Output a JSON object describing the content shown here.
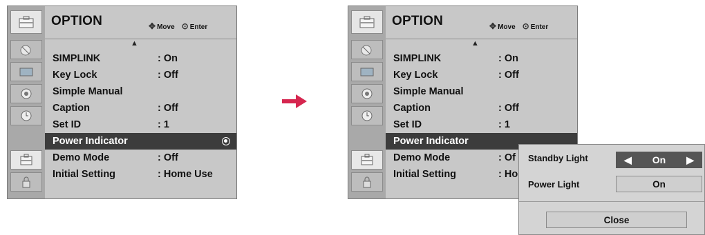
{
  "menu": {
    "title": "OPTION",
    "nav_move": "Move",
    "nav_enter": "Enter",
    "rows": [
      {
        "label": "SIMPLINK",
        "value": ": On"
      },
      {
        "label": "Key Lock",
        "value": ": Off"
      },
      {
        "label": "Simple Manual",
        "value": ""
      },
      {
        "label": "Caption",
        "value": ": Off"
      },
      {
        "label": "Set ID",
        "value": ": 1"
      },
      {
        "label": "Power Indicator",
        "value": ""
      },
      {
        "label": "Demo Mode",
        "value": ": Off"
      },
      {
        "label": "Initial Setting",
        "value": ": Home Use"
      }
    ],
    "right_truncated_values": {
      "demo": ": Of",
      "initial": ": Ho"
    }
  },
  "popup": {
    "standby_label": "Standby Light",
    "standby_value": "On",
    "power_label": "Power Light",
    "power_value": "On",
    "close_label": "Close"
  },
  "colors": {
    "arrow": "#d6264f",
    "highlight": "#3c3c3c"
  },
  "icons": [
    "satellite-icon",
    "tv-screen-icon",
    "speaker-icon",
    "clock-icon",
    "toolbox-icon",
    "lock-icon"
  ]
}
